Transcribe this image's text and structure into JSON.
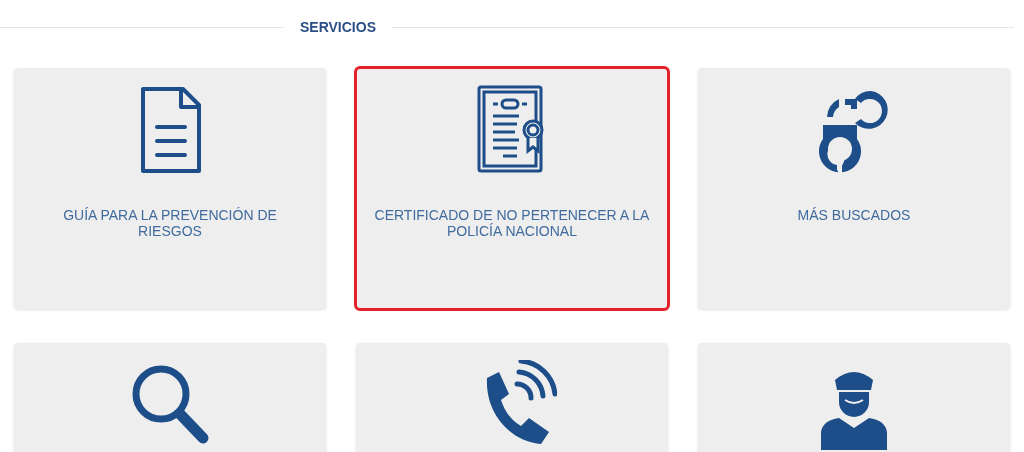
{
  "section_title": "SERVICIOS",
  "cards": [
    {
      "label": "GUÍA PARA LA PREVENCIÓN DE RIESGOS",
      "selected": false
    },
    {
      "label": "CERTIFICADO DE NO PERTENECER A LA POLICÍA NACIONAL",
      "selected": true
    },
    {
      "label": "MÁS BUSCADOS",
      "selected": false
    },
    {
      "selected": false
    },
    {
      "selected": false
    },
    {
      "selected": false
    }
  ]
}
